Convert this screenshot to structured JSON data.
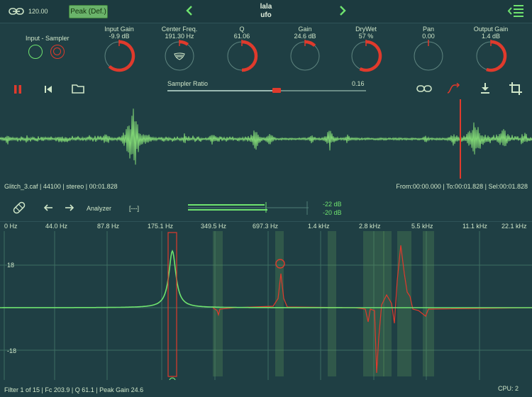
{
  "header": {
    "tempo": "120.00",
    "mode_button": "Peak (Def.)",
    "preset_line1": "lala",
    "preset_line2": "ufo"
  },
  "input_section": {
    "label": "Input - Sampler"
  },
  "knobs": [
    {
      "id": "input-gain",
      "label": "Input Gain",
      "value": "-9.9 dB",
      "level": 0.62
    },
    {
      "id": "center-freq",
      "label": "Center Freq.",
      "value": "191.30 Hz",
      "level": 0.1
    },
    {
      "id": "q",
      "label": "Q",
      "value": "61.06",
      "level": 0.5
    },
    {
      "id": "gain",
      "label": "Gain",
      "value": "24.6 dB",
      "level": 0.12
    },
    {
      "id": "drywet",
      "label": "DryWet",
      "value": "57 %",
      "level": 0.57
    },
    {
      "id": "pan",
      "label": "Pan",
      "value": "0.00",
      "level": 0.0
    },
    {
      "id": "output-gain",
      "label": "Output Gain",
      "value": "1.4 dB",
      "level": 0.55
    }
  ],
  "sampler": {
    "label": "Sampler Ratio",
    "value": "0.16",
    "level": 0.55
  },
  "file_info": {
    "details": "Glitch_3.caf | 44100 | stereo  | 00:01.828",
    "selection": "From:00:00.000 | To:00:01.828 | Sel:00:01.828"
  },
  "analyzer": {
    "label": "Analyzer",
    "bracket": "[---]",
    "meter_top": "-22 dB",
    "meter_bottom": "-20 dB"
  },
  "freq_axis": [
    "0 Hz",
    "44.0 Hz",
    "87.8 Hz",
    "175.1 Hz",
    "349.5 Hz",
    "697.3 Hz",
    "1.4 kHz",
    "2.8 kHz",
    "5.5 kHz",
    "11.1 kHz",
    "22.1 kHz"
  ],
  "db_axis": {
    "top": "18",
    "bottom": "-18"
  },
  "footer": {
    "filter_info": "Filter 1 of 15 | Fc 203.9 | Q 61.1 | Peak Gain 24.6",
    "cpu": "CPU: 2"
  },
  "colors": {
    "background": "#1f3f44",
    "accent_green": "#6fe36f",
    "accent_red": "#e03a2c"
  }
}
